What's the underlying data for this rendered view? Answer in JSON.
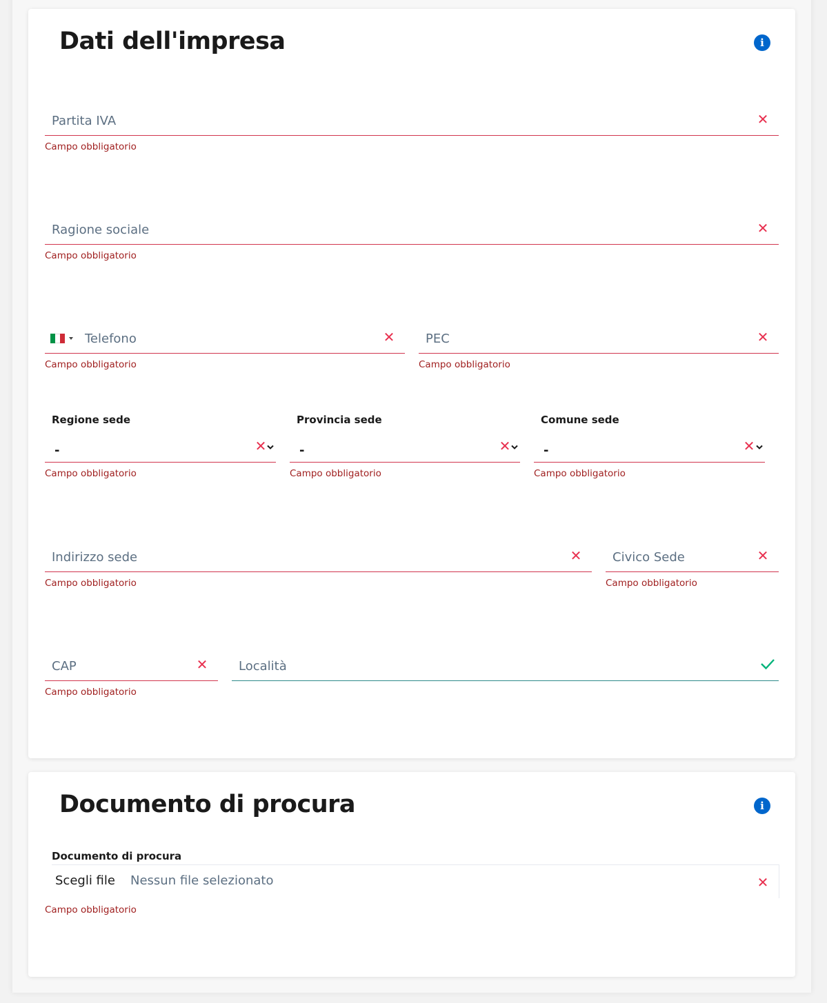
{
  "colors": {
    "error": "#d1344d",
    "error_text": "#a02020",
    "accent": "#0066cc",
    "valid": "#00b37a",
    "placeholder": "#5c6f82"
  },
  "section_company": {
    "title": "Dati dell'impresa",
    "info_icon": "info-icon",
    "partita_iva": {
      "placeholder": "Partita IVA",
      "error": "Campo obbligatorio"
    },
    "ragione_sociale": {
      "placeholder": "Ragione sociale",
      "error": "Campo obbligatorio"
    },
    "telefono": {
      "placeholder": "Telefono",
      "country_flag": "Italy",
      "error": "Campo obbligatorio"
    },
    "pec": {
      "placeholder": "PEC",
      "error": "Campo obbligatorio"
    },
    "regione": {
      "label": "Regione sede",
      "value": "-",
      "error": "Campo obbligatorio"
    },
    "provincia": {
      "label": "Provincia sede",
      "value": "-",
      "error": "Campo obbligatorio"
    },
    "comune": {
      "label": "Comune sede",
      "value": "-",
      "error": "Campo obbligatorio"
    },
    "indirizzo": {
      "placeholder": "Indirizzo sede",
      "error": "Campo obbligatorio"
    },
    "civico": {
      "placeholder": "Civico Sede",
      "error": "Campo obbligatorio"
    },
    "cap": {
      "placeholder": "CAP",
      "error": "Campo obbligatorio"
    },
    "localita": {
      "placeholder": "Località",
      "status": "valid"
    }
  },
  "section_document": {
    "title": "Documento di procura",
    "info_icon": "info-icon",
    "file": {
      "label": "Documento di procura",
      "button": "Scegli file",
      "status": "Nessun file selezionato",
      "error": "Campo obbligatorio"
    }
  },
  "icons": {
    "info_glyph": "i",
    "error_glyph": "✕"
  }
}
